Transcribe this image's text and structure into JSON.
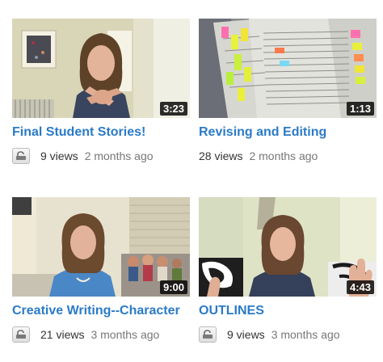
{
  "videos": [
    {
      "title": "Final Student Stories!",
      "duration": "3:23",
      "views": "9 views",
      "age": "2 months ago",
      "thumbnail_icon": "woman-gesturing-thumbnail"
    },
    {
      "title": "Revising and Editing",
      "duration": "1:13",
      "views": "28 views",
      "age": "2 months ago",
      "thumbnail_icon": "papers-sticky-notes-thumbnail"
    },
    {
      "title": "Creative Writing--Character",
      "duration": "9:00",
      "views": "21 views",
      "age": "3 months ago",
      "thumbnail_icon": "woman-with-dolls-thumbnail"
    },
    {
      "title": "OUTLINES",
      "duration": "4:43",
      "views": "9 views",
      "age": "3 months ago",
      "thumbnail_icon": "woman-raising-hand-thumbnail"
    }
  ],
  "colors": {
    "title_link": "#2b7bc7",
    "duration_bg": "#000000",
    "meta_text": "#333333",
    "age_text": "#777777"
  }
}
